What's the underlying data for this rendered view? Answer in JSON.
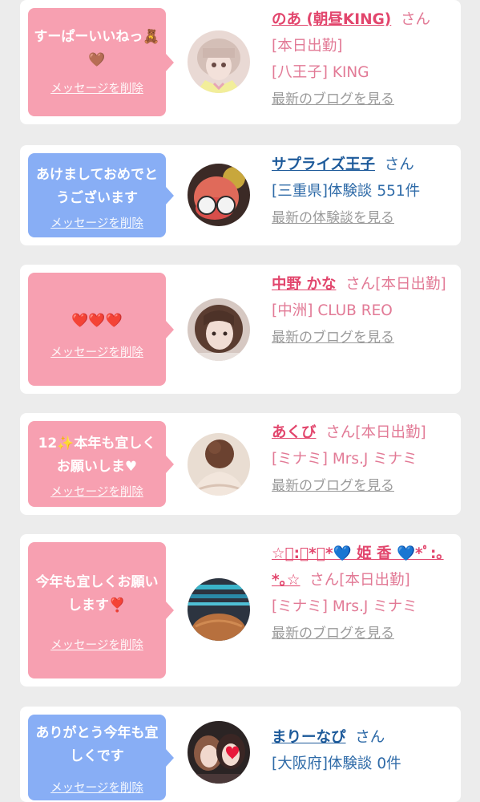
{
  "cards": [
    {
      "bubble_color": "#f7a0b1",
      "message": "すーぱーいいねっ🧸🤎",
      "delete_label": "メッセージを削除",
      "avatar_icon": "avatar-photo-girl-bangs",
      "name": "のあ (朝昼KING)",
      "honorific": "さん",
      "status": "[本日出勤]",
      "shop": "[八王子] KING",
      "link": "最新のブログを見る"
    },
    {
      "bubble_color": "#88aef5",
      "message": "あけましておめでとうございます",
      "delete_label": "メッセージを削除",
      "avatar_icon": "avatar-photo-sunglasses",
      "name": "サプライズ王子",
      "honorific": "さん",
      "status": "",
      "shop": "[三重県]体験談 551件",
      "link": "最新の体験談を見る"
    },
    {
      "bubble_color": "#f7a0b1",
      "message": "❤️❤️❤️",
      "delete_label": "メッセージを削除",
      "avatar_icon": "avatar-photo-girl",
      "name": "中野 かな",
      "honorific": "さん",
      "status": "[本日出勤]",
      "shop": "[中洲] CLUB REO",
      "link": "最新のブログを見る"
    },
    {
      "bubble_color": "#f7a0b1",
      "message": "12✨本年も宜しくお願いしま♥",
      "delete_label": "メッセージを削除",
      "avatar_icon": "avatar-photo-back",
      "name": "あくび",
      "honorific": "さん",
      "status": "[本日出勤]",
      "shop": "[ミナミ] Mrs.J ミナミ",
      "link": "最新のブログを見る"
    },
    {
      "bubble_color": "#f7a0b1",
      "message": "今年も宜しくお願いします❣️",
      "delete_label": "メッセージを削除",
      "avatar_icon": "avatar-photo-hair",
      "name": "☆ﾟ:｡*｡*💙 姫 香 💙*ﾟ:｡*｡☆",
      "honorific": "さん",
      "status": "[本日出勤]",
      "shop": "[ミナミ] Mrs.J ミナミ",
      "link": "最新のブログを見る"
    },
    {
      "bubble_color": "#88aef5",
      "message": "ありがとう今年も宜しくです",
      "delete_label": "メッセージを削除",
      "avatar_icon": "avatar-photo-two-girls",
      "name": "まりーなぴ",
      "honorific": "さん",
      "status": "",
      "shop": "[大阪府]体験談 0件",
      "link": ""
    }
  ]
}
